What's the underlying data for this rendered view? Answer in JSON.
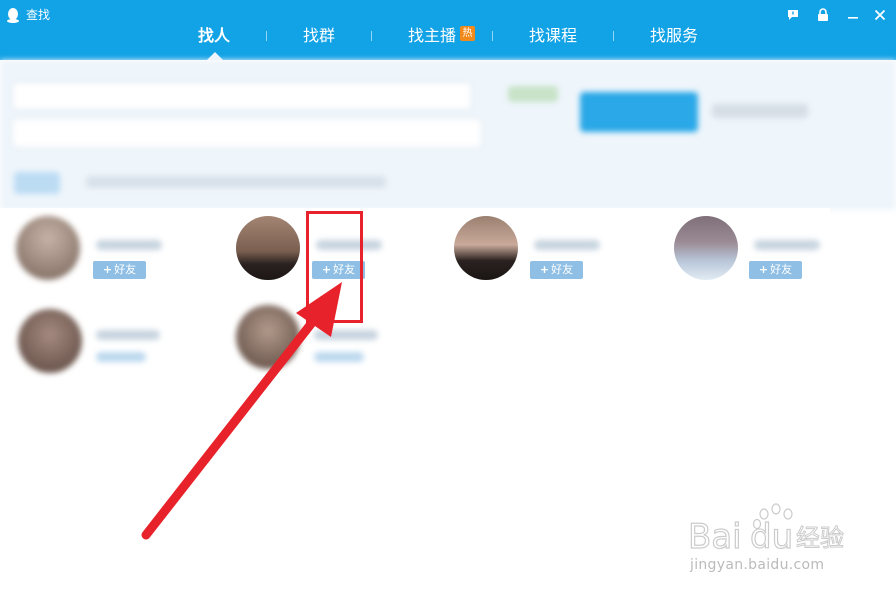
{
  "window": {
    "title": "查找",
    "accent_color": "#12a2e6",
    "controls": [
      "feedback-icon",
      "lock-icon",
      "minimize-icon",
      "close-icon"
    ]
  },
  "tabs": [
    {
      "label": "找人",
      "active": true
    },
    {
      "label": "找群",
      "active": false
    },
    {
      "label": "找主播",
      "active": false,
      "badge": "热"
    },
    {
      "label": "找课程",
      "active": false
    },
    {
      "label": "找服务",
      "active": false
    }
  ],
  "results": {
    "add_friend_plus": "+",
    "add_friend_label": "好友",
    "visible_cards": 4,
    "blurred_cards": 2
  },
  "annotation": {
    "color": "#e8222a"
  },
  "watermark": {
    "brand": "Bai du 经验",
    "url": "jingyan.baidu.com"
  }
}
